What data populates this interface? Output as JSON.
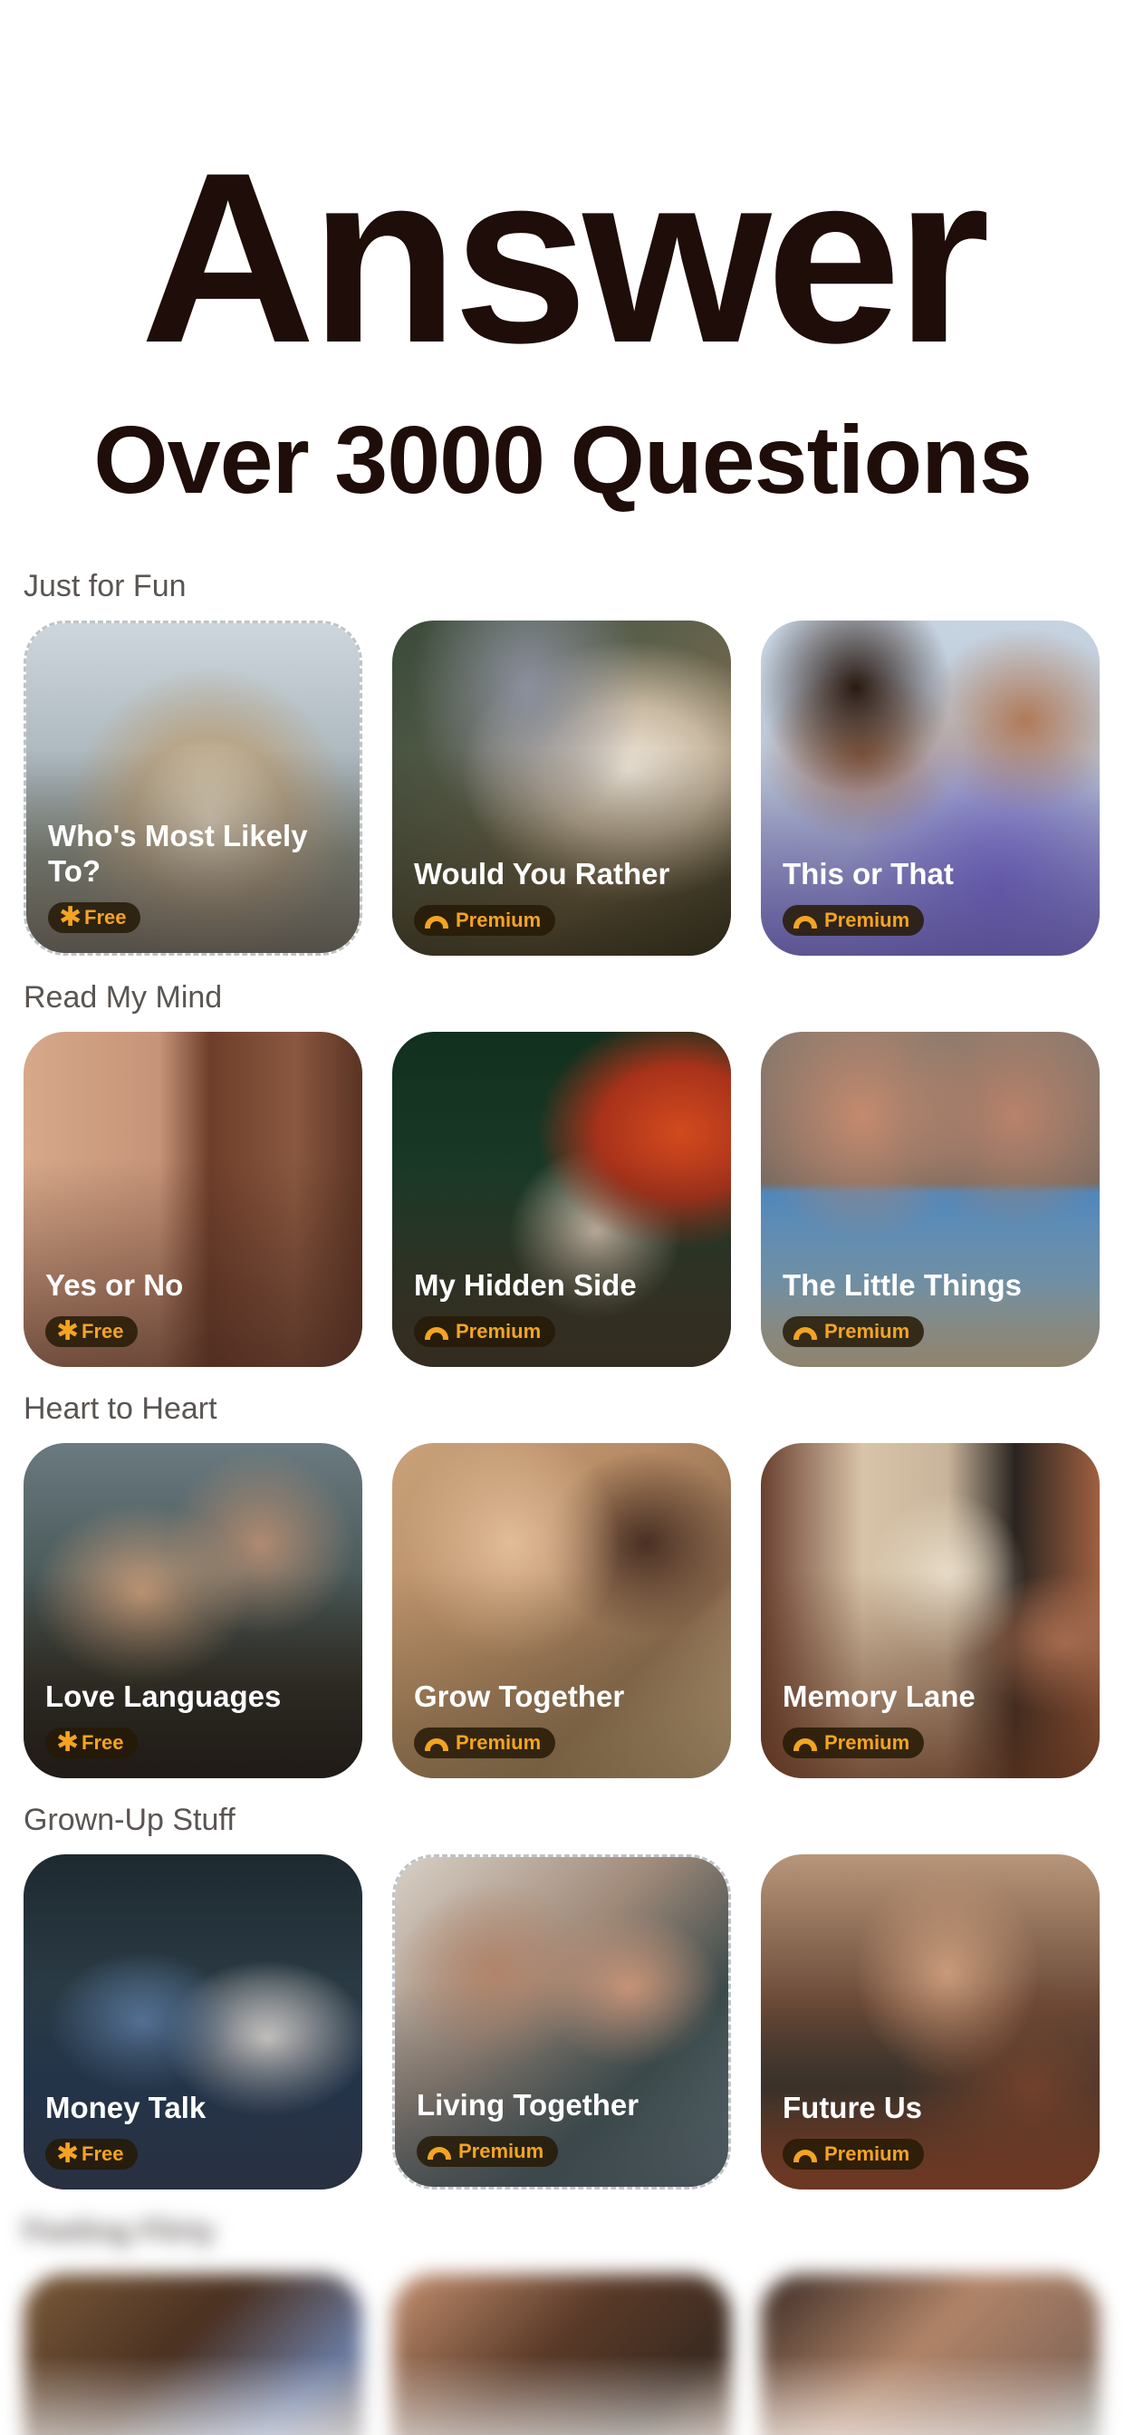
{
  "hero": {
    "title": "Answer",
    "subtitle": "Over 3000 Questions"
  },
  "badge_labels": {
    "free": "Free",
    "premium": "Premium"
  },
  "colors": {
    "text_dark": "#1e0d08",
    "badge_accent": "#f4a422",
    "section_label": "#5a5552"
  },
  "sections": [
    {
      "label": "Just for Fun",
      "cards": [
        {
          "title": "Who's Most Likely To?",
          "badge": "Free"
        },
        {
          "title": "Would You Rather",
          "badge": "Premium"
        },
        {
          "title": "This or That",
          "badge": "Premium"
        }
      ]
    },
    {
      "label": "Read My Mind",
      "cards": [
        {
          "title": "Yes or No",
          "badge": "Free"
        },
        {
          "title": "My Hidden Side",
          "badge": "Premium"
        },
        {
          "title": "The Little Things",
          "badge": "Premium"
        }
      ]
    },
    {
      "label": "Heart to Heart",
      "cards": [
        {
          "title": "Love Languages",
          "badge": "Free"
        },
        {
          "title": "Grow Together",
          "badge": "Premium"
        },
        {
          "title": "Memory Lane",
          "badge": "Premium"
        }
      ]
    },
    {
      "label": "Grown-Up Stuff",
      "cards": [
        {
          "title": "Money Talk",
          "badge": "Free"
        },
        {
          "title": "Living Together",
          "badge": "Premium"
        },
        {
          "title": "Future Us",
          "badge": "Premium"
        }
      ]
    },
    {
      "label": "Feeling Flirty",
      "cards": []
    }
  ],
  "icons": {
    "free": "asterisk-icon",
    "premium": "rainbow-icon"
  }
}
